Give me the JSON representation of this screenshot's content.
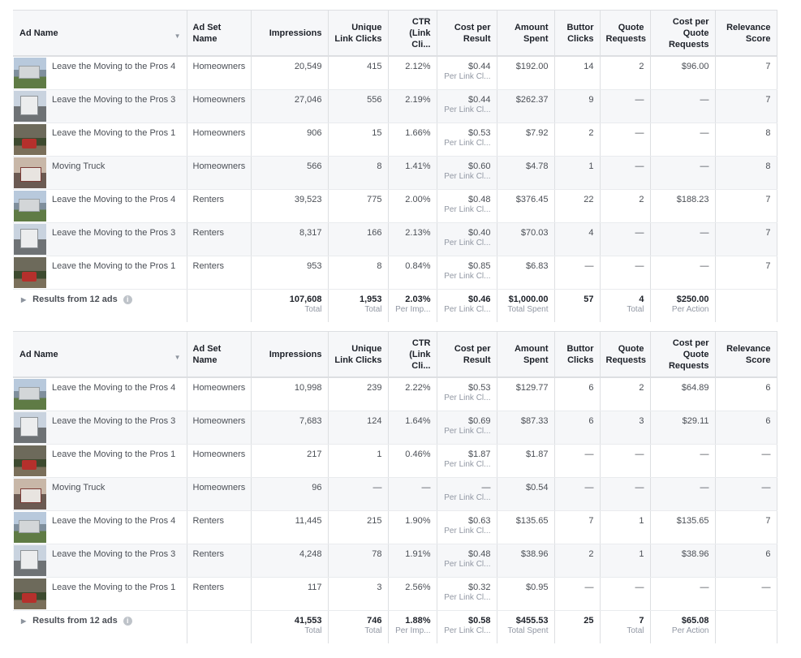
{
  "columns": [
    "Ad Name",
    "Ad Set Name",
    "Impressions",
    "Unique Link Clicks",
    "CTR (Link Cli...",
    "Cost per Result",
    "Amount Spent",
    "Button Clicks",
    "Quote Requests",
    "Cost per Quote Requests",
    "Relevance Score"
  ],
  "headers": {
    "ad_name": "Ad Name",
    "ad_set_name": "Ad Set Name",
    "impressions": "Impressions",
    "unique_link_clicks": "Unique Link Clicks",
    "ctr": "CTR (Link Cli...",
    "cost_per_result": "Cost per Result",
    "amount_spent": "Amount Spent",
    "button_clicks": "Buttor Clicks",
    "quote_requests": "Quote Requests",
    "cost_per_quote": "Cost per Quote Requests",
    "relevance_score": "Relevance Score"
  },
  "icons": {
    "sort": "chevron-down-icon",
    "expand": "triangle-right-icon",
    "info": "info-icon"
  },
  "tables": [
    {
      "rows": [
        {
          "thumb": "house",
          "ad": "Leave the Moving to the Pros 4",
          "adset": "Homeowners",
          "imp": "20,549",
          "ulc": "415",
          "ctr": "2.12%",
          "cpr": "$0.44",
          "cpr_sub": "Per Link Cl...",
          "spent": "$192.00",
          "btn": "14",
          "qr": "2",
          "cpq": "$96.00",
          "rel": "7"
        },
        {
          "thumb": "truck",
          "ad": "Leave the Moving to the Pros 3",
          "adset": "Homeowners",
          "imp": "27,046",
          "ulc": "556",
          "ctr": "2.19%",
          "cpr": "$0.44",
          "cpr_sub": "Per Link Cl...",
          "spent": "$262.37",
          "btn": "9",
          "qr": "—",
          "cpq": "—",
          "rel": "7"
        },
        {
          "thumb": "night",
          "ad": "Leave the Moving to the Pros 1",
          "adset": "Homeowners",
          "imp": "906",
          "ulc": "15",
          "ctr": "1.66%",
          "cpr": "$0.53",
          "cpr_sub": "Per Link Cl...",
          "spent": "$7.92",
          "btn": "2",
          "qr": "—",
          "cpq": "—",
          "rel": "8"
        },
        {
          "thumb": "van",
          "ad": "Moving Truck",
          "adset": "Homeowners",
          "imp": "566",
          "ulc": "8",
          "ctr": "1.41%",
          "cpr": "$0.60",
          "cpr_sub": "Per Link Cl...",
          "spent": "$4.78",
          "btn": "1",
          "qr": "—",
          "cpq": "—",
          "rel": "8"
        },
        {
          "thumb": "house",
          "ad": "Leave the Moving to the Pros 4",
          "adset": "Renters",
          "imp": "39,523",
          "ulc": "775",
          "ctr": "2.00%",
          "cpr": "$0.48",
          "cpr_sub": "Per Link Cl...",
          "spent": "$376.45",
          "btn": "22",
          "qr": "2",
          "cpq": "$188.23",
          "rel": "7"
        },
        {
          "thumb": "truck",
          "ad": "Leave the Moving to the Pros 3",
          "adset": "Renters",
          "imp": "8,317",
          "ulc": "166",
          "ctr": "2.13%",
          "cpr": "$0.40",
          "cpr_sub": "Per Link Cl...",
          "spent": "$70.03",
          "btn": "4",
          "qr": "—",
          "cpq": "—",
          "rel": "7"
        },
        {
          "thumb": "night",
          "ad": "Leave the Moving to the Pros 1",
          "adset": "Renters",
          "imp": "953",
          "ulc": "8",
          "ctr": "0.84%",
          "cpr": "$0.85",
          "cpr_sub": "Per Link Cl...",
          "spent": "$6.83",
          "btn": "—",
          "qr": "—",
          "cpq": "—",
          "rel": "7"
        }
      ],
      "total": {
        "label": "Results from 12 ads",
        "imp": "107,608",
        "imp_sub": "Total",
        "ulc": "1,953",
        "ulc_sub": "Total",
        "ctr": "2.03%",
        "ctr_sub": "Per Imp...",
        "cpr": "$0.46",
        "cpr_sub": "Per Link Cl...",
        "spent": "$1,000.00",
        "spent_sub": "Total Spent",
        "btn": "57",
        "btn_sub": "",
        "qr": "4",
        "qr_sub": "Total",
        "cpq": "$250.00",
        "cpq_sub": "Per Action"
      }
    },
    {
      "rows": [
        {
          "thumb": "house",
          "ad": "Leave the Moving to the Pros 4",
          "adset": "Homeowners",
          "imp": "10,998",
          "ulc": "239",
          "ctr": "2.22%",
          "cpr": "$0.53",
          "cpr_sub": "Per Link Cl...",
          "spent": "$129.77",
          "btn": "6",
          "qr": "2",
          "cpq": "$64.89",
          "rel": "6"
        },
        {
          "thumb": "truck",
          "ad": "Leave the Moving to the Pros 3",
          "adset": "Homeowners",
          "imp": "7,683",
          "ulc": "124",
          "ctr": "1.64%",
          "cpr": "$0.69",
          "cpr_sub": "Per Link Cl...",
          "spent": "$87.33",
          "btn": "6",
          "qr": "3",
          "cpq": "$29.11",
          "rel": "6"
        },
        {
          "thumb": "night",
          "ad": "Leave the Moving to the Pros 1",
          "adset": "Homeowners",
          "imp": "217",
          "ulc": "1",
          "ctr": "0.46%",
          "cpr": "$1.87",
          "cpr_sub": "Per Link Cl...",
          "spent": "$1.87",
          "btn": "—",
          "qr": "—",
          "cpq": "—",
          "rel": "—"
        },
        {
          "thumb": "van",
          "ad": "Moving Truck",
          "adset": "Homeowners",
          "imp": "96",
          "ulc": "—",
          "ctr": "—",
          "cpr": "—",
          "cpr_sub": "Per Link Cl...",
          "spent": "$0.54",
          "btn": "—",
          "qr": "—",
          "cpq": "—",
          "rel": "—"
        },
        {
          "thumb": "house",
          "ad": "Leave the Moving to the Pros 4",
          "adset": "Renters",
          "imp": "11,445",
          "ulc": "215",
          "ctr": "1.90%",
          "cpr": "$0.63",
          "cpr_sub": "Per Link Cl...",
          "spent": "$135.65",
          "btn": "7",
          "qr": "1",
          "cpq": "$135.65",
          "rel": "7"
        },
        {
          "thumb": "truck",
          "ad": "Leave the Moving to the Pros 3",
          "adset": "Renters",
          "imp": "4,248",
          "ulc": "78",
          "ctr": "1.91%",
          "cpr": "$0.48",
          "cpr_sub": "Per Link Cl...",
          "spent": "$38.96",
          "btn": "2",
          "qr": "1",
          "cpq": "$38.96",
          "rel": "6"
        },
        {
          "thumb": "night",
          "ad": "Leave the Moving to the Pros 1",
          "adset": "Renters",
          "imp": "117",
          "ulc": "3",
          "ctr": "2.56%",
          "cpr": "$0.32",
          "cpr_sub": "Per Link Cl...",
          "spent": "$0.95",
          "btn": "—",
          "qr": "—",
          "cpq": "—",
          "rel": "—"
        }
      ],
      "total": {
        "label": "Results from 12 ads",
        "imp": "41,553",
        "imp_sub": "Total",
        "ulc": "746",
        "ulc_sub": "Total",
        "ctr": "1.88%",
        "ctr_sub": "Per Imp...",
        "cpr": "$0.58",
        "cpr_sub": "Per Link Cl...",
        "spent": "$455.53",
        "spent_sub": "Total Spent",
        "btn": "25",
        "btn_sub": "",
        "qr": "7",
        "qr_sub": "Total",
        "cpq": "$65.08",
        "cpq_sub": "Per Action"
      }
    }
  ]
}
